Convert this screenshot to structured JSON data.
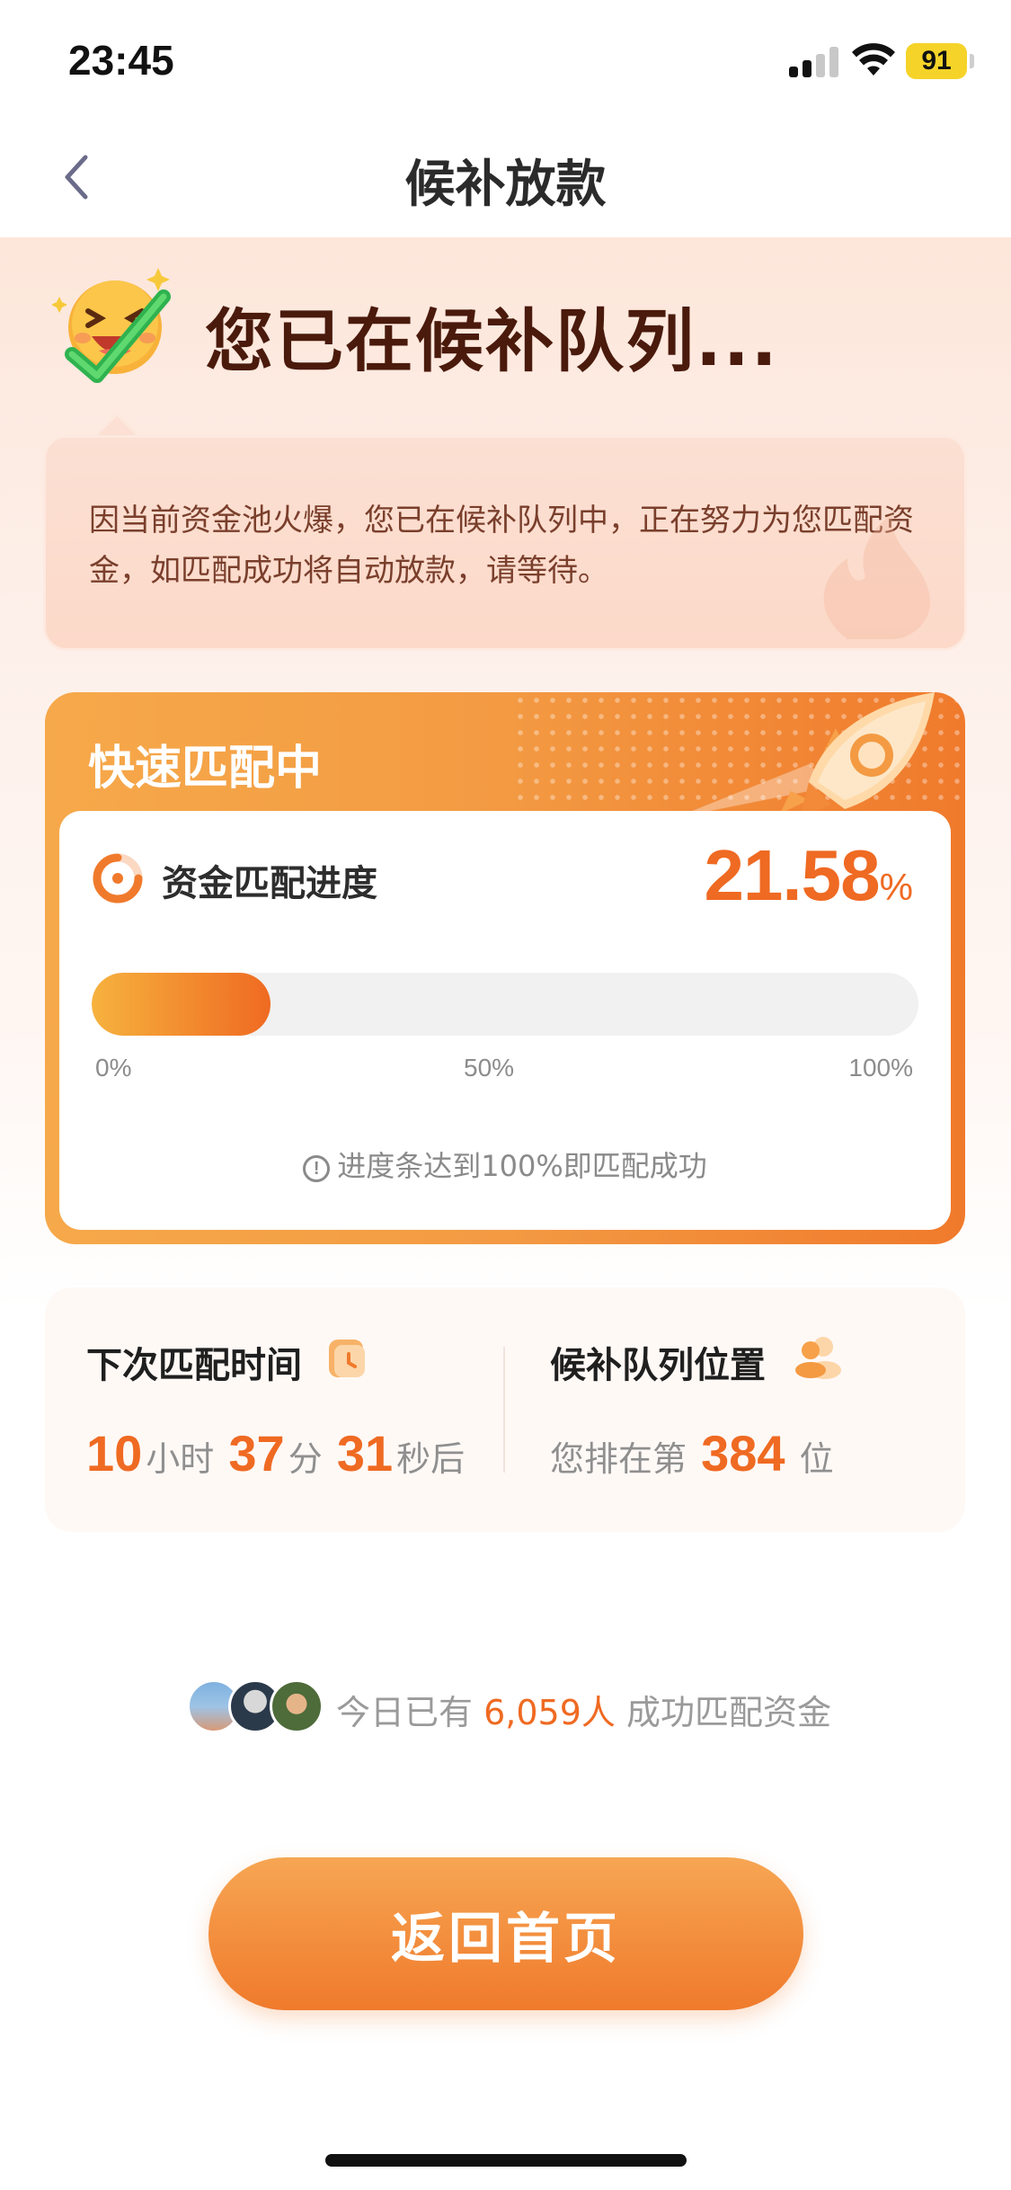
{
  "status_bar": {
    "time": "23:45",
    "battery_level": "91",
    "icons": [
      "signal-icon",
      "wifi-icon",
      "battery-icon"
    ]
  },
  "nav": {
    "title": "候补放款",
    "back_icon": "chevron-left-icon"
  },
  "hero": {
    "title": "您已在候补队列...",
    "icon": "laughing-emoji-check-icon"
  },
  "notice": {
    "text": "因当前资金池火爆，您已在候补队列中，正在努力为您匹配资金，如匹配成功将自动放款，请等待。"
  },
  "match_card": {
    "header": "快速匹配中",
    "progress_label": "资金匹配进度",
    "progress_value": "21.58",
    "progress_unit": "%",
    "progress_fraction": 0.2158,
    "ticks": [
      "0%",
      "50%",
      "100%"
    ],
    "hint": "进度条达到100%即匹配成功",
    "colors": {
      "accent": "#ef6a22",
      "gradient_start": "#f6b23e"
    }
  },
  "stats": {
    "next_match": {
      "title": "下次匹配时间",
      "hours": "10",
      "hours_unit": "小时",
      "minutes": "37",
      "minutes_unit": "分",
      "seconds": "31",
      "seconds_unit": "秒后"
    },
    "queue": {
      "title": "候补队列位置",
      "prefix": "您排在第",
      "position": "384",
      "suffix": "位"
    }
  },
  "social": {
    "prefix": "今日已有",
    "count": "6,059人",
    "suffix": "成功匹配资金"
  },
  "button": {
    "label": "返回首页"
  }
}
